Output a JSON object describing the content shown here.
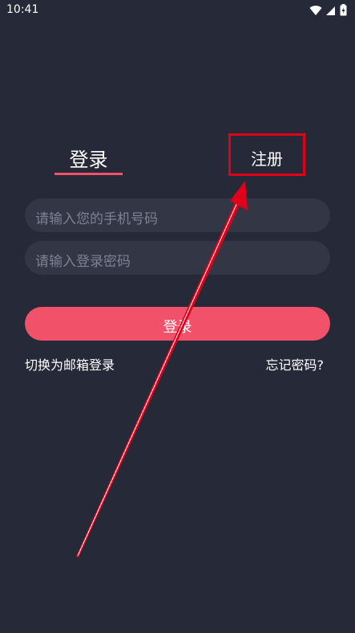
{
  "status_bar": {
    "time": "10:41",
    "icons": [
      "wifi-icon",
      "cellular-signal-icon",
      "battery-icon"
    ]
  },
  "tabs": {
    "login_label": "登录",
    "register_label": "注册"
  },
  "form": {
    "phone_placeholder": "请输入您的手机号码",
    "password_placeholder": "请输入登录密码",
    "login_button_label": "登录"
  },
  "links": {
    "switch_email": "切换为邮箱登录",
    "forgot_password": "忘记密码?"
  },
  "colors": {
    "background": "#262a38",
    "accent": "#f1526a",
    "annotation": "#e0001a"
  }
}
